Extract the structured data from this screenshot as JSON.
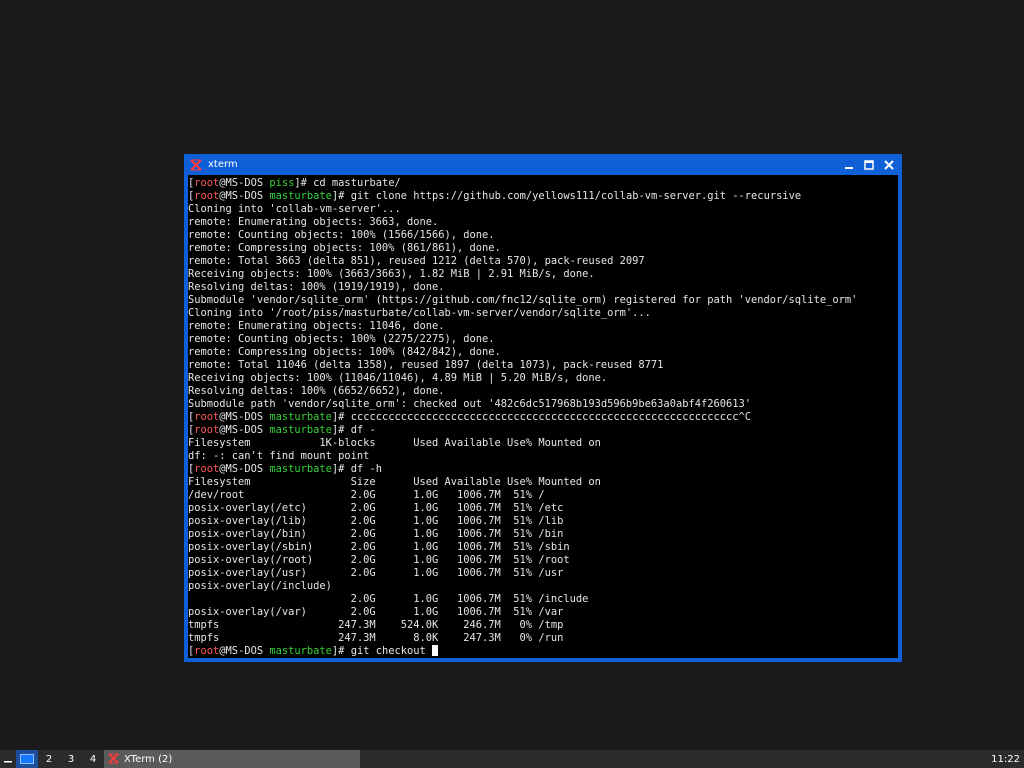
{
  "window": {
    "title": "xterm",
    "controls": [
      "minimize",
      "maximize",
      "close"
    ]
  },
  "terminal": {
    "prompt": {
      "user": "root",
      "host": "MS-DOS"
    },
    "lines": [
      {
        "type": "prompt",
        "dir": "piss",
        "cmd": "cd masturbate/"
      },
      {
        "type": "prompt",
        "dir": "masturbate",
        "cmd": "git clone https://github.com/yellows111/collab-vm-server.git --recursive"
      },
      {
        "type": "out",
        "text": "Cloning into 'collab-vm-server'..."
      },
      {
        "type": "out",
        "text": "remote: Enumerating objects: 3663, done."
      },
      {
        "type": "out",
        "text": "remote: Counting objects: 100% (1566/1566), done."
      },
      {
        "type": "out",
        "text": "remote: Compressing objects: 100% (861/861), done."
      },
      {
        "type": "out",
        "text": "remote: Total 3663 (delta 851), reused 1212 (delta 570), pack-reused 2097"
      },
      {
        "type": "out",
        "text": "Receiving objects: 100% (3663/3663), 1.82 MiB | 2.91 MiB/s, done."
      },
      {
        "type": "out",
        "text": "Resolving deltas: 100% (1919/1919), done."
      },
      {
        "type": "out",
        "text": "Submodule 'vendor/sqlite_orm' (https://github.com/fnc12/sqlite_orm) registered for path 'vendor/sqlite_orm'"
      },
      {
        "type": "out",
        "text": "Cloning into '/root/piss/masturbate/collab-vm-server/vendor/sqlite_orm'..."
      },
      {
        "type": "out",
        "text": "remote: Enumerating objects: 11046, done."
      },
      {
        "type": "out",
        "text": "remote: Counting objects: 100% (2275/2275), done."
      },
      {
        "type": "out",
        "text": "remote: Compressing objects: 100% (842/842), done."
      },
      {
        "type": "out",
        "text": "remote: Total 11046 (delta 1358), reused 1897 (delta 1073), pack-reused 8771"
      },
      {
        "type": "out",
        "text": "Receiving objects: 100% (11046/11046), 4.89 MiB | 5.20 MiB/s, done."
      },
      {
        "type": "out",
        "text": "Resolving deltas: 100% (6652/6652), done."
      },
      {
        "type": "out",
        "text": "Submodule path 'vendor/sqlite_orm': checked out '482c6dc517968b193d596b9be63a0abf4f260613'"
      },
      {
        "type": "prompt",
        "dir": "masturbate",
        "cmd": "cccccccccccccccccccccccccccccccccccccccccccccccccccccccccccccc^C"
      },
      {
        "type": "prompt",
        "dir": "masturbate",
        "cmd": "df -"
      },
      {
        "type": "out",
        "text": "Filesystem           1K-blocks      Used Available Use% Mounted on"
      },
      {
        "type": "out",
        "text": "df: -: can't find mount point"
      },
      {
        "type": "prompt",
        "dir": "masturbate",
        "cmd": "df -h"
      },
      {
        "type": "out",
        "text": "Filesystem                Size      Used Available Use% Mounted on"
      },
      {
        "type": "out",
        "text": "/dev/root                 2.0G      1.0G   1006.7M  51% /"
      },
      {
        "type": "out",
        "text": "posix-overlay(/etc)       2.0G      1.0G   1006.7M  51% /etc"
      },
      {
        "type": "out",
        "text": "posix-overlay(/lib)       2.0G      1.0G   1006.7M  51% /lib"
      },
      {
        "type": "out",
        "text": "posix-overlay(/bin)       2.0G      1.0G   1006.7M  51% /bin"
      },
      {
        "type": "out",
        "text": "posix-overlay(/sbin)      2.0G      1.0G   1006.7M  51% /sbin"
      },
      {
        "type": "out",
        "text": "posix-overlay(/root)      2.0G      1.0G   1006.7M  51% /root"
      },
      {
        "type": "out",
        "text": "posix-overlay(/usr)       2.0G      1.0G   1006.7M  51% /usr"
      },
      {
        "type": "out",
        "text": "posix-overlay(/include)"
      },
      {
        "type": "out",
        "text": "                          2.0G      1.0G   1006.7M  51% /include"
      },
      {
        "type": "out",
        "text": "posix-overlay(/var)       2.0G      1.0G   1006.7M  51% /var"
      },
      {
        "type": "out",
        "text": "tmpfs                   247.3M    524.0K    246.7M   0% /tmp"
      },
      {
        "type": "out",
        "text": "tmpfs                   247.3M      8.0K    247.3M   0% /run"
      },
      {
        "type": "prompt",
        "dir": "masturbate",
        "cmd": "git checkout ",
        "cursor": true
      }
    ]
  },
  "taskbar": {
    "workspaces": [
      "1",
      "2",
      "3",
      "4"
    ],
    "active_workspace": "1",
    "task_label": "XTerm (2)",
    "clock": "11:22"
  },
  "icons": {
    "app": "xterm-x-icon",
    "menu": "menu-underscore-icon"
  },
  "colors": {
    "window_frame": "#0f5fd6",
    "prompt_user": "#ff5a5a",
    "prompt_dir": "#37d037",
    "terminal_fg": "#e6e6e6",
    "terminal_bg": "#000000"
  }
}
